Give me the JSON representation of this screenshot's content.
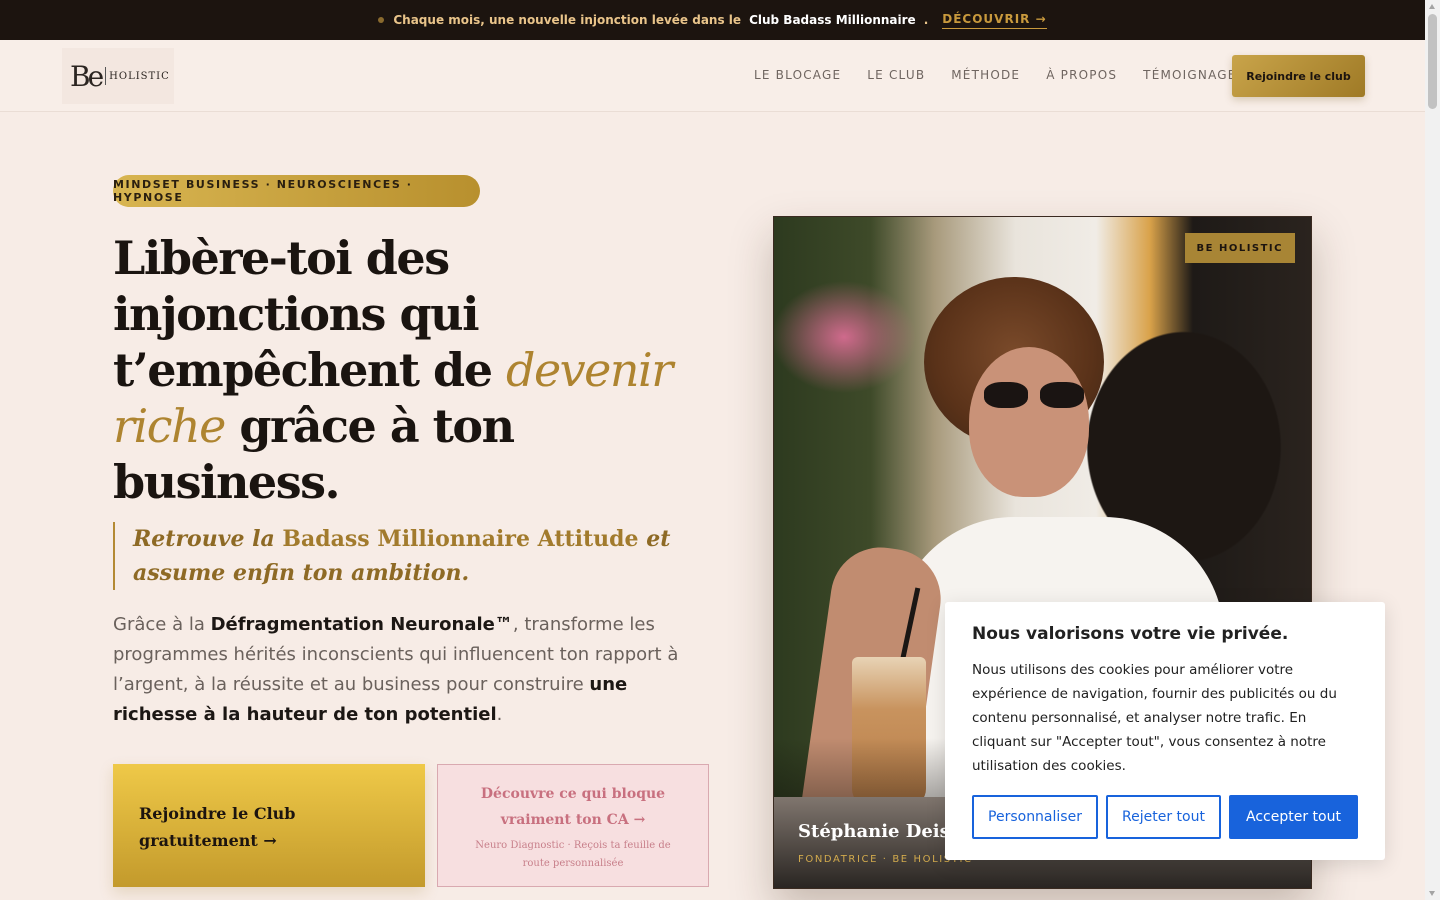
{
  "announcement": {
    "text": "Chaque mois, une nouvelle injonction levée dans le",
    "club": "Club Badass Millionnaire",
    "separator": ".",
    "cta": "DÉCOUVRIR →"
  },
  "header": {
    "logo_mark": "Be",
    "logo_word": "HOLISTIC",
    "nav": [
      "LE BLOCAGE",
      "LE CLUB",
      "MÉTHODE",
      "À PROPOS",
      "TÉMOIGNAGES"
    ],
    "cta": "Rejoindre le club"
  },
  "hero": {
    "tagline": "MINDSET BUSINESS · NEUROSCIENCES · HYPNOSE",
    "headline_before": "Libère-toi des injonctions qui t’empêchent de ",
    "headline_accent": "devenir riche",
    "headline_after": " grâce à ton business.",
    "quote_before": "Retrouve la ",
    "quote_strong": "Badass Millionnaire Attitude",
    "quote_after": " et assume enfin ton ambition.",
    "lead_1": "Grâce à la ",
    "lead_strong_1": "Défragmentation Neuronale™",
    "lead_2": ", transforme les programmes hérités inconscients qui influencent ton rapport à l’argent, à la réussite et au business pour construire ",
    "lead_strong_2": "une richesse à la hauteur de ton potentiel",
    "lead_3": ".",
    "primary_cta": "Rejoindre le Club gratuitement →",
    "secondary_cta_title": "Découvre ce qui bloque vraiment ton CA →",
    "secondary_cta_sub": "Neuro Diagnostic · Reçois ta feuille de route personnalisée"
  },
  "portrait": {
    "badge": "BE HOLISTIC",
    "name": "Stéphanie Deiss",
    "role": "FONDATRICE · BE HOLISTIC"
  },
  "cookie": {
    "title": "Nous valorisons votre vie privée.",
    "body": "Nous utilisons des cookies pour améliorer votre expérience de navigation, fournir des publicités ou du contenu personnalisé, et analyser notre trafic. En cliquant sur \"Accepter tout\", vous consentez à notre utilisation des cookies.",
    "customize": "Personnaliser",
    "reject": "Rejeter tout",
    "accept": "Accepter tout",
    "accent_color": "#1863dc"
  }
}
